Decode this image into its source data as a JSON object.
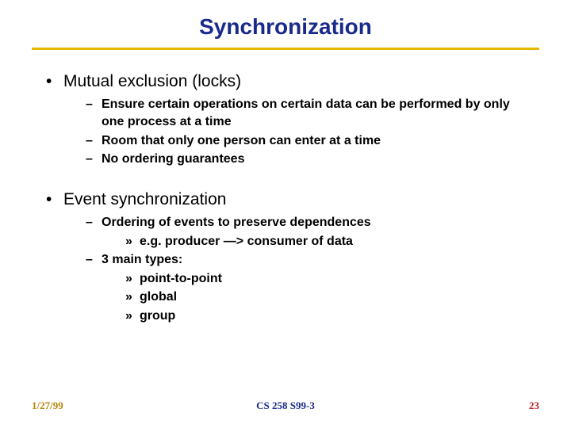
{
  "title": "Synchronization",
  "bullets": {
    "p1": "Mutual exclusion (locks)",
    "p1a": "Ensure certain operations on certain data can be performed by only one process at a time",
    "p1b": "Room that only one person can enter at a time",
    "p1c": "No ordering guarantees",
    "p2": " Event synchronization",
    "p2a": " Ordering of events to preserve dependences",
    "p2a1": "e.g.  producer —> consumer of data",
    "p2b": "3 main types:",
    "p2b1": "point-to-point",
    "p2b2": "global",
    "p2b3": "group"
  },
  "footer": {
    "date": "1/27/99",
    "course": "CS 258 S99-3",
    "pageno": "23"
  }
}
